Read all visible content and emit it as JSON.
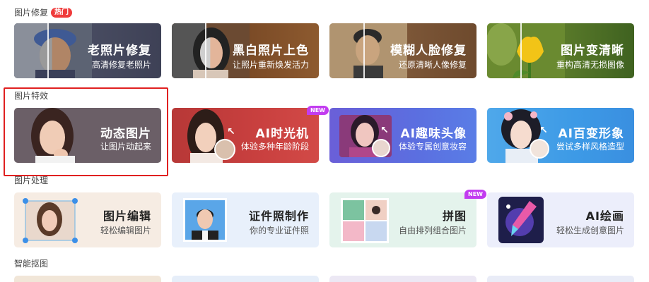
{
  "sections": {
    "repair": {
      "title": "图片修复",
      "badge": "热门"
    },
    "effects": {
      "title": "图片特效"
    },
    "processing": {
      "title": "图片处理"
    },
    "cutout": {
      "title": "智能抠图"
    }
  },
  "repair_cards": [
    {
      "title": "老照片修复",
      "sub": "高清修复老照片",
      "bg": "#4a4e63"
    },
    {
      "title": "黑白照片上色",
      "sub": "让照片重新焕发活力",
      "bg": "#7a4a26"
    },
    {
      "title": "模糊人脸修复",
      "sub": "还原清晰人像修复",
      "bg": "#7d5738"
    },
    {
      "title": "图片变清晰",
      "sub": "重构高清无损图像",
      "bg": "#5a7a2a"
    }
  ],
  "effect_cards": [
    {
      "title": "动态图片",
      "sub": "让图片动起来",
      "bg": "#6b5f67"
    },
    {
      "title": "AI时光机",
      "sub": "体验多种年龄阶段",
      "bg": "#c9403f",
      "badge": "NEW"
    },
    {
      "title": "AI趣味头像",
      "sub": "体验专属创意妆容",
      "bg": "#5b6fe0"
    },
    {
      "title": "AI百变形象",
      "sub": "尝试多样风格造型",
      "bg": "#3d9ae6"
    }
  ],
  "tool_cards": [
    {
      "title": "图片编辑",
      "sub": "轻松编辑图片",
      "bg": "#f6ece3"
    },
    {
      "title": "证件照制作",
      "sub": "你的专业证件照",
      "bg": "#e8f0fb"
    },
    {
      "title": "拼图",
      "sub": "自由排列组合图片",
      "bg": "#e4f3ec",
      "badge": "NEW"
    },
    {
      "title": "AI绘画",
      "sub": "轻松生成创意图片",
      "bg": "#eceefb"
    }
  ],
  "colors": {
    "highlight_border": "#e02020",
    "hot_badge": "#ef3b3b",
    "new_badge": "#c23cf0"
  }
}
